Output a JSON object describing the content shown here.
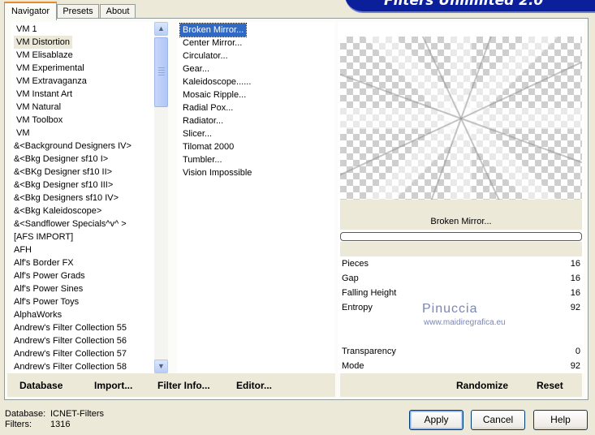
{
  "banner": {
    "title": "Filters Unlimited 2.0"
  },
  "tabs": [
    "Navigator",
    "Presets",
    "About"
  ],
  "categories": [
    "VM 1",
    "VM Distortion",
    "VM Elisablaze",
    "VM Experimental",
    "VM Extravaganza",
    "VM Instant Art",
    "VM Natural",
    "VM Toolbox",
    "VM",
    "&<Background Designers IV>",
    "&<Bkg Designer sf10 I>",
    "&<BKg Designer sf10 II>",
    "&<Bkg Designer sf10 III>",
    "&<Bkg Designers sf10 IV>",
    "&<Bkg Kaleidoscope>",
    "&<Sandflower Specials^v^ >",
    "[AFS IMPORT]",
    "AFH",
    "Alf's Border FX",
    "Alf's Power Grads",
    "Alf's Power Sines",
    "Alf's Power Toys",
    "AlphaWorks",
    "Andrew's Filter Collection 55",
    "Andrew's Filter Collection 56",
    "Andrew's Filter Collection 57",
    "Andrew's Filter Collection 58"
  ],
  "selected_category": "VM Distortion",
  "filters": [
    "Broken Mirror...",
    "Center Mirror...",
    "Circulator...",
    "Gear...",
    "Kaleidoscope......",
    "Mosaic Ripple...",
    "Radial Pox...",
    "Radiator...",
    "Slicer...",
    "Tilomat 2000",
    "Tumbler...",
    "Vision Impossible"
  ],
  "selected_filter": "Broken Mirror...",
  "preview": {
    "filter_name": "Broken Mirror...",
    "progress": 0
  },
  "params": [
    {
      "label": "Pieces",
      "value": "16"
    },
    {
      "label": "Gap",
      "value": "16"
    },
    {
      "label": "Falling Height",
      "value": "16"
    },
    {
      "label": "Entropy",
      "value": "92"
    },
    {
      "label": "Transparency",
      "value": "0"
    },
    {
      "label": "Mode",
      "value": "92"
    }
  ],
  "watermark": {
    "name": "Pinuccia",
    "site": "www.maidiregrafica.eu"
  },
  "linkbar": {
    "database": "Database",
    "import": "Import...",
    "filter_info": "Filter Info...",
    "editor": "Editor...",
    "randomize": "Randomize",
    "reset": "Reset"
  },
  "status": {
    "database_label": "Database:",
    "database_value": "ICNET-Filters",
    "filters_label": "Filters:",
    "filters_value": "1316"
  },
  "buttons": {
    "apply": "Apply",
    "cancel": "Cancel",
    "help": "Help"
  },
  "colors": {
    "banner": "#0c1f9a",
    "selection": "#316ac5",
    "tab_accent": "#e68b2c"
  }
}
